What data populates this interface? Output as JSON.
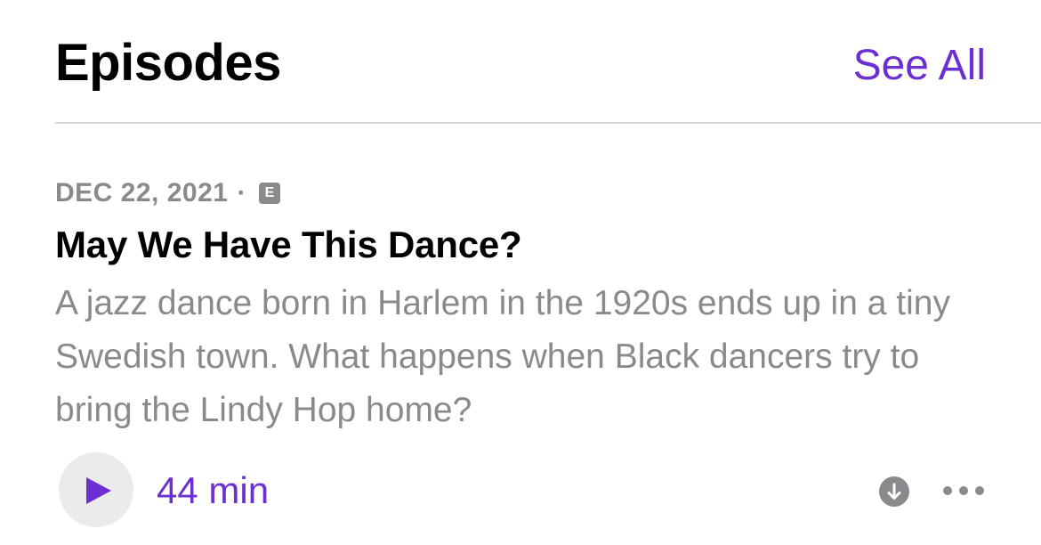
{
  "colors": {
    "accent": "#6c2fd1",
    "secondary_text": "#8a8a8e",
    "primary_text": "#000000",
    "play_button_bg": "#ebebed",
    "divider": "#d8d8da"
  },
  "header": {
    "title": "Episodes",
    "see_all_label": "See All"
  },
  "episode": {
    "date": "DEC 22, 2021",
    "separator": "·",
    "explicit_badge": "E",
    "title": "May We Have This Dance?",
    "description": "A jazz dance born in Harlem in the 1920s ends up in a tiny Swedish town. What happens when Black dancers try to bring the Lindy Hop home?",
    "duration": "44 min"
  },
  "icons": {
    "play": "play-icon",
    "download": "download-arrow-icon",
    "more": "ellipsis-icon"
  }
}
